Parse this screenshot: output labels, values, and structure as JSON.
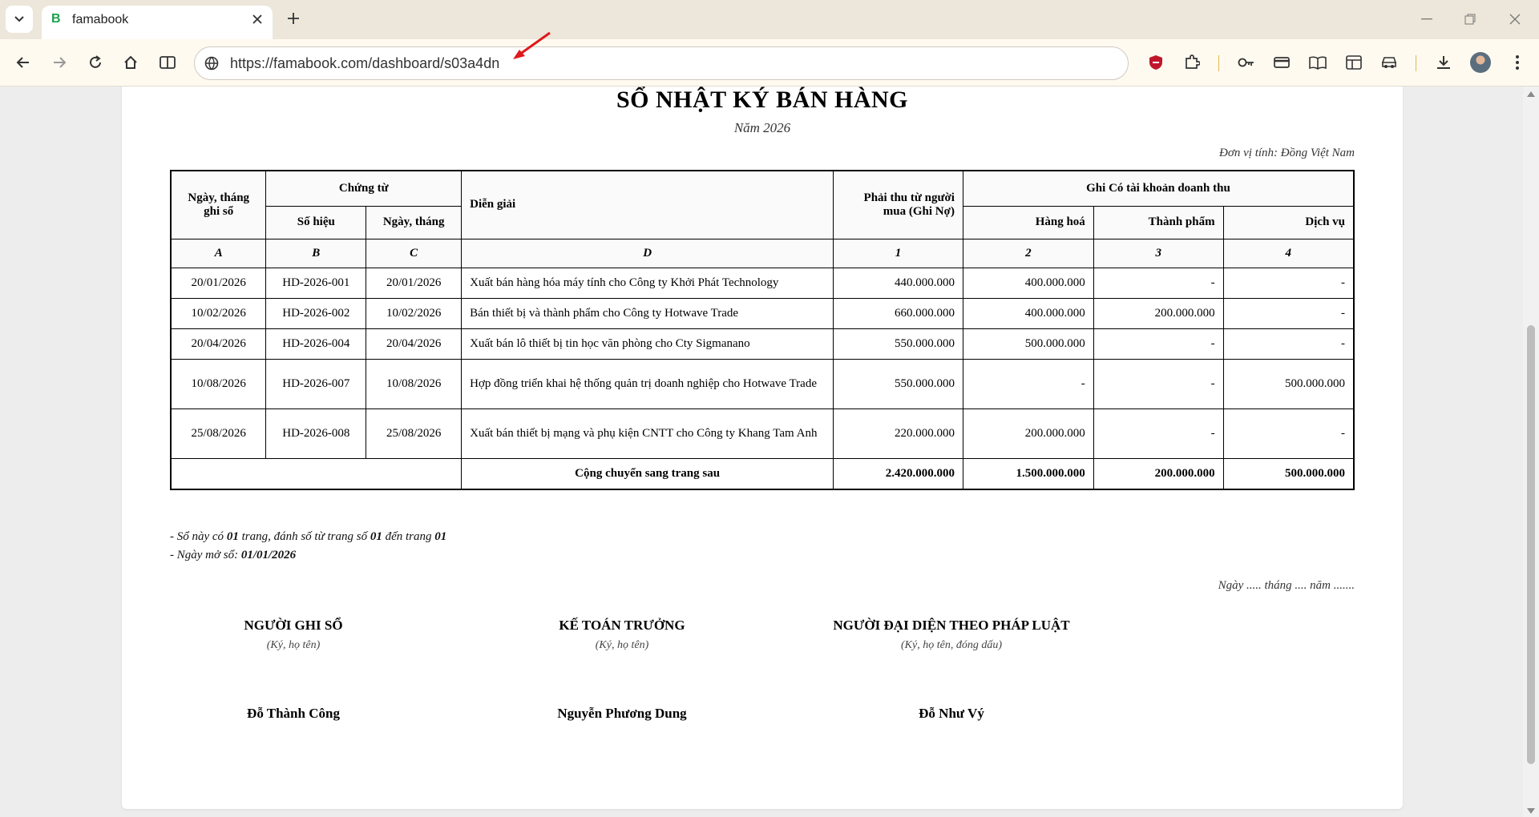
{
  "browser": {
    "tab": {
      "favicon": "B",
      "title": "famabook"
    },
    "url": "https://famabook.com/dashboard/s03a4dn",
    "colors": {
      "accent": "#1aa14a",
      "shield": "#c0162b",
      "annotation_arrow": "#e0191b"
    }
  },
  "document": {
    "title": "SỔ NHẬT KÝ BÁN HÀNG",
    "year": "Năm 2026",
    "unit": "Đơn vị tính: Đồng Việt Nam",
    "table": {
      "headers": {
        "date": "Ngày, tháng ghi sổ",
        "voucher": "Chứng từ",
        "voucher_no": "Số hiệu",
        "voucher_date": "Ngày, tháng",
        "description": "Diễn giải",
        "receivable": "Phải thu từ người mua (Ghi Nợ)",
        "credit_group": "Ghi Có tài khoản doanh thu",
        "goods": "Hàng hoá",
        "products": "Thành phẩm",
        "services": "Dịch vụ"
      },
      "column_codes": [
        "A",
        "B",
        "C",
        "D",
        "1",
        "2",
        "3",
        "4"
      ],
      "rows": [
        {
          "date": "20/01/2026",
          "no": "HD-2026-001",
          "vdate": "20/01/2026",
          "desc": "Xuất bán hàng hóa máy tính cho Công ty Khởi Phát Technology",
          "receivable": "440.000.000",
          "goods": "400.000.000",
          "products": "-",
          "services": "-"
        },
        {
          "date": "10/02/2026",
          "no": "HD-2026-002",
          "vdate": "10/02/2026",
          "desc": "Bán thiết bị và thành phẩm cho Công ty Hotwave Trade",
          "receivable": "660.000.000",
          "goods": "400.000.000",
          "products": "200.000.000",
          "services": "-"
        },
        {
          "date": "20/04/2026",
          "no": "HD-2026-004",
          "vdate": "20/04/2026",
          "desc": "Xuất bán lô thiết bị tin học văn phòng cho Cty Sigmanano",
          "receivable": "550.000.000",
          "goods": "500.000.000",
          "products": "-",
          "services": "-"
        },
        {
          "date": "10/08/2026",
          "no": "HD-2026-007",
          "vdate": "10/08/2026",
          "desc": "Hợp đồng triển khai hệ thống quản trị doanh nghiệp cho Hotwave Trade",
          "receivable": "550.000.000",
          "goods": "-",
          "products": "-",
          "services": "500.000.000"
        },
        {
          "date": "25/08/2026",
          "no": "HD-2026-008",
          "vdate": "25/08/2026",
          "desc": "Xuất bán thiết bị mạng và phụ kiện CNTT cho Công ty Khang Tam Anh",
          "receivable": "220.000.000",
          "goods": "200.000.000",
          "products": "-",
          "services": "-"
        }
      ],
      "total": {
        "label": "Cộng chuyển sang trang sau",
        "receivable": "2.420.000.000",
        "goods": "1.500.000.000",
        "products": "200.000.000",
        "services": "500.000.000"
      }
    },
    "notes": {
      "pages_prefix": "- Sổ này có ",
      "pages_count": "01",
      "pages_mid": " trang, đánh số từ trang số ",
      "pages_from": "01",
      "pages_to_text": " đến trang ",
      "pages_to": "01",
      "open_prefix": "- Ngày mở sổ: ",
      "open_date": "01/01/2026"
    },
    "sign_date": "Ngày ..... tháng .... năm .......",
    "signatures": [
      {
        "title": "NGƯỜI GHI SỔ",
        "hint": "(Ký, họ tên)",
        "name": "Đỗ Thành Công"
      },
      {
        "title": "KẾ TOÁN TRƯỞNG",
        "hint": "(Ký, họ tên)",
        "name": "Nguyễn Phương Dung"
      },
      {
        "title": "NGƯỜI ĐẠI DIỆN THEO PHÁP LUẬT",
        "hint": "(Ký, họ tên, đóng dấu)",
        "name": "Đỗ Như Vý"
      }
    ]
  }
}
